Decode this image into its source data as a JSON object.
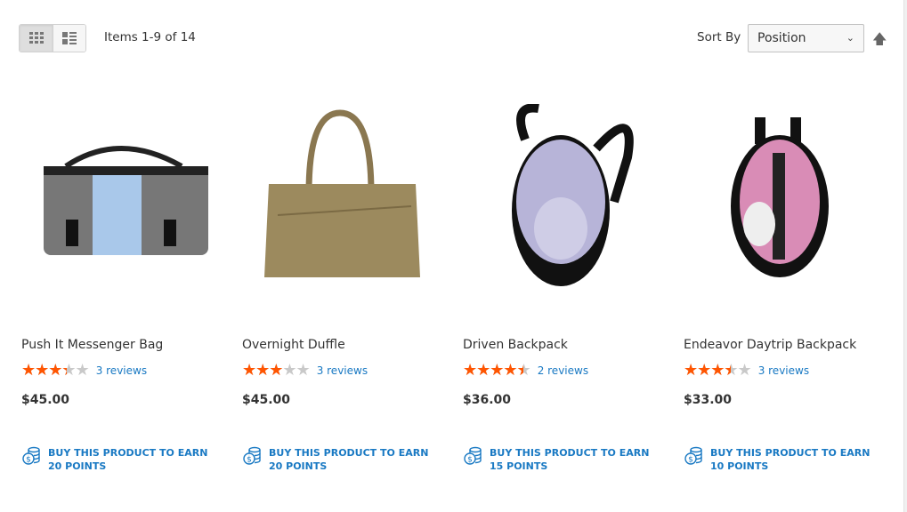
{
  "toolbar": {
    "view_modes": [
      {
        "name": "grid",
        "active": true
      },
      {
        "name": "list",
        "active": false
      }
    ],
    "amount": "Items 1-9 of 14",
    "sort_label": "Sort By",
    "sort_value": "Position",
    "sort_direction": "ascending"
  },
  "colors": {
    "star": "#ff5501",
    "link": "#1979c3"
  },
  "products": [
    {
      "name": "Push It Messenger Bag",
      "rating_percent": 67,
      "reviews": "3 reviews",
      "price": "$45.00",
      "points": "BUY THIS PRODUCT TO EARN 20 POINTS"
    },
    {
      "name": "Overnight Duffle",
      "rating_percent": 60,
      "reviews": "3 reviews",
      "price": "$45.00",
      "points": "BUY THIS PRODUCT TO EARN 20 POINTS"
    },
    {
      "name": "Driven Backpack",
      "rating_percent": 90,
      "reviews": "2 reviews",
      "price": "$36.00",
      "points": "BUY THIS PRODUCT TO EARN 15 POINTS"
    },
    {
      "name": "Endeavor Daytrip Backpack",
      "rating_percent": 70,
      "reviews": "3 reviews",
      "price": "$33.00",
      "points": "BUY THIS PRODUCT TO EARN 10 POINTS"
    }
  ]
}
